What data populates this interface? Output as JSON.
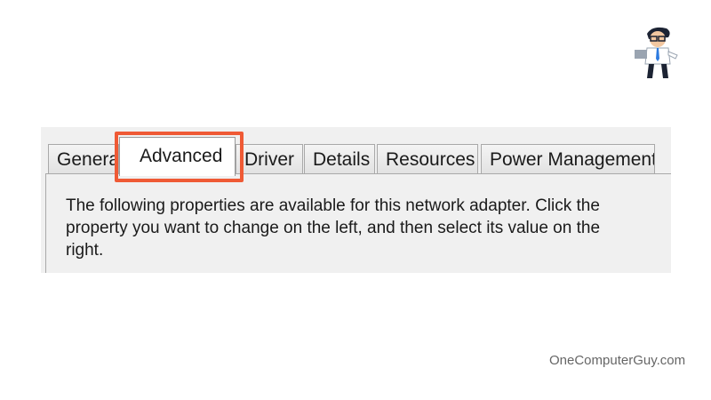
{
  "logo_alt": "OneComputerGuy mascot",
  "tabs": [
    {
      "label": "General",
      "active": false
    },
    {
      "label": "Advanced",
      "active": true
    },
    {
      "label": "Driver",
      "active": false
    },
    {
      "label": "Details",
      "active": false
    },
    {
      "label": "Resources",
      "active": false
    },
    {
      "label": "Power Management",
      "active": false
    }
  ],
  "description": "The following properties are available for this network adapter. Click the property you want to change on the left, and then select its value on the right.",
  "highlight_color": "#ef5a35",
  "watermark": "OneComputerGuy.com"
}
